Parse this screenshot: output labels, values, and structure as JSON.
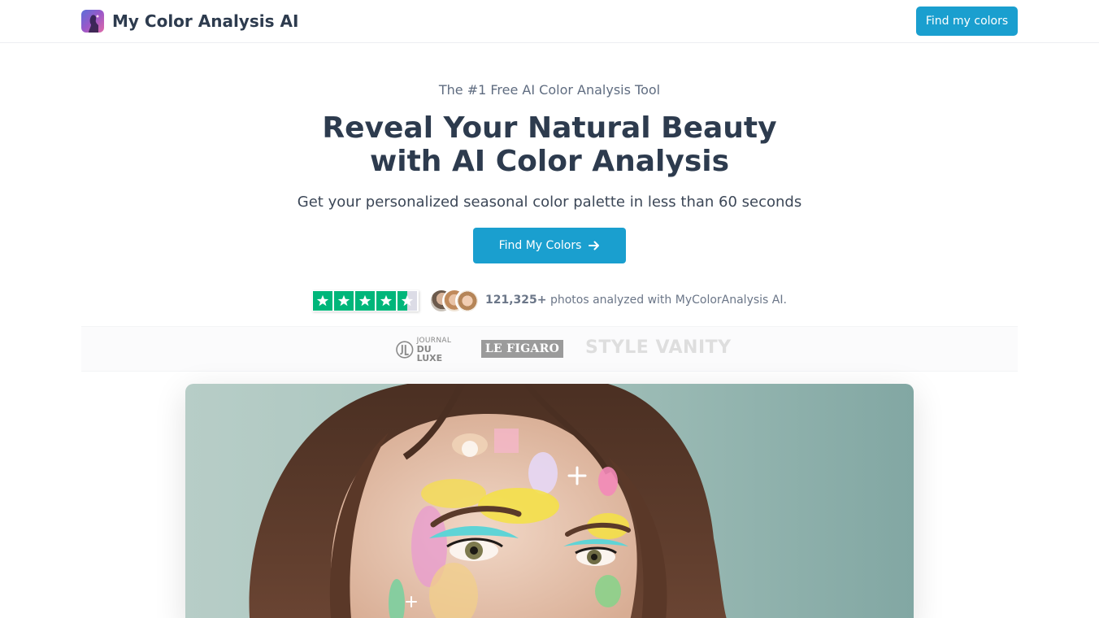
{
  "brand": {
    "name": "My Color Analysis AI",
    "logo_icon": "woman-silhouette-logo-icon"
  },
  "nav": {
    "cta_label": "Find my colors"
  },
  "hero": {
    "eyebrow": "The #1 Free AI Color Analysis Tool",
    "headline_line1": "Reveal Your Natural Beauty",
    "headline_line2": "with AI Color Analysis",
    "subheadline": "Get your personalized seasonal color palette in less than 60 seconds",
    "cta_label": "Find My Colors",
    "cta_icon": "arrow-right-icon"
  },
  "social_proof": {
    "rating_stars": 4.5,
    "rating_max": 5,
    "count": "121,325+",
    "text": "photos analyzed with MyColorAnalysis AI.",
    "avatar_count": 3
  },
  "press": {
    "logos": [
      "JOURNAL DU LUXE",
      "LE FIGARO",
      "STYLE VANITY"
    ],
    "jdl_line1": "JOURNAL",
    "jdl_line2": "DU LUXE",
    "figaro": "LE FIGARO",
    "style_vanity": "STYLE VANITY"
  },
  "colors": {
    "accent": "#1a9fcf",
    "heading": "#2d3b4e",
    "muted": "#6b7688",
    "trustpilot_green": "#00b67a"
  }
}
